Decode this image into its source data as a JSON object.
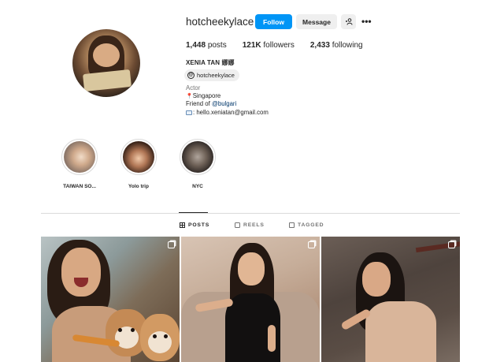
{
  "profile": {
    "username": "hotcheekylace",
    "buttons": {
      "follow": "Follow",
      "message": "Message",
      "add_user_icon": "add-user-icon",
      "more_icon": "more-icon",
      "more_glyph": "•••"
    },
    "stats": [
      {
        "count": "1,448",
        "label": "posts"
      },
      {
        "count": "121K",
        "label": "followers"
      },
      {
        "count": "2,433",
        "label": "following"
      }
    ],
    "full_name": "XENIA TAN 娜娜",
    "threads_handle": "hotcheekylace",
    "category": "Actor",
    "bio": {
      "location": "Singapore",
      "friend_prefix": "Friend of ",
      "friend_link": "@bulgari",
      "email": ": hello.xeniatan@gmail.com"
    }
  },
  "highlights": [
    {
      "label": "TAIWAN SO..."
    },
    {
      "label": "Yolo trip"
    },
    {
      "label": "NYC"
    }
  ],
  "tabs": [
    {
      "label": "POSTS",
      "active": true
    },
    {
      "label": "REELS",
      "active": false
    },
    {
      "label": "TAGGED",
      "active": false
    }
  ],
  "colors": {
    "accent": "#0095f6",
    "link": "#00376b",
    "text": "#262626",
    "muted": "#737373",
    "button_bg": "#efefef"
  }
}
